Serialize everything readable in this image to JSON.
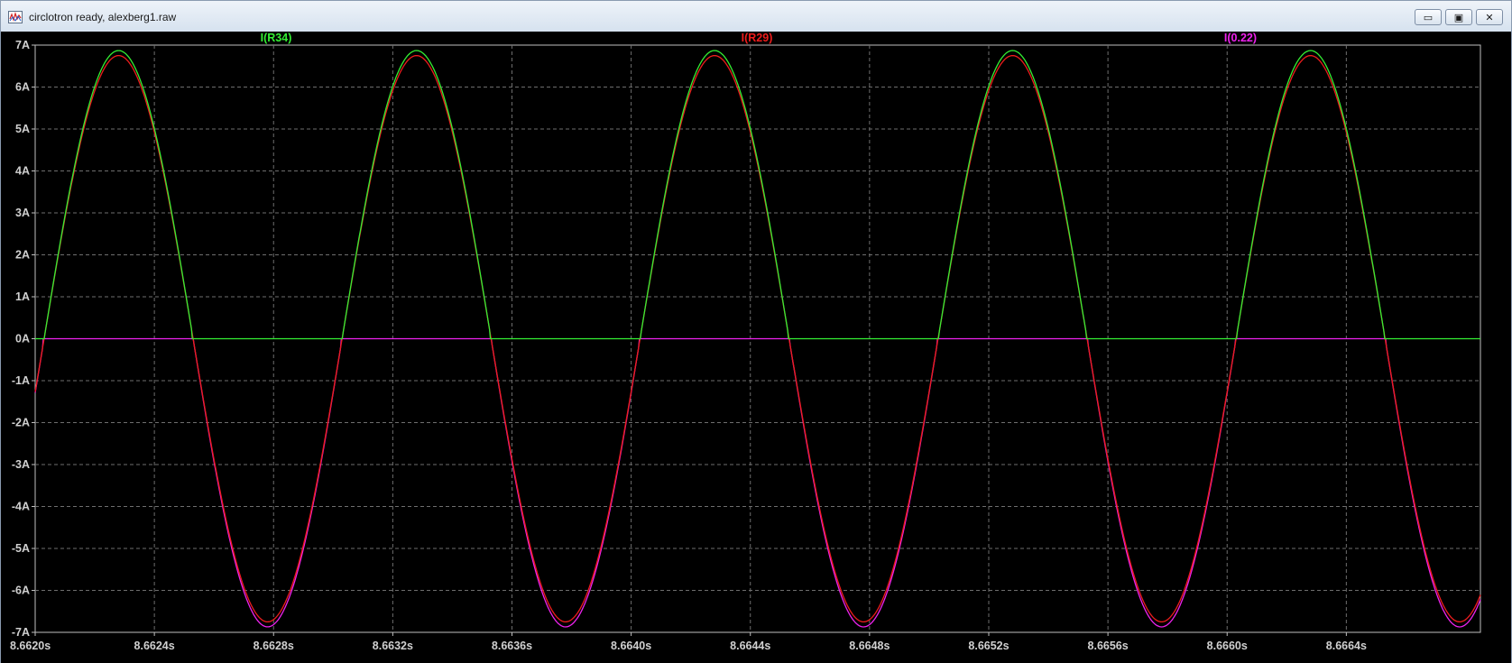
{
  "window": {
    "title": "circlotron ready, alexberg1.raw",
    "buttons": {
      "minimize": "▭",
      "maximize": "▣",
      "close": "✕"
    }
  },
  "chart_data": {
    "type": "line",
    "title": "",
    "xlabel": "",
    "ylabel": "",
    "xlim": [
      8.662,
      8.66685
    ],
    "ylim": [
      -7,
      7
    ],
    "grid": true,
    "legend": "top",
    "background": "#000000",
    "x_ticks": [
      "8.6620s",
      "8.6624s",
      "8.6628s",
      "8.6632s",
      "8.6636s",
      "8.6640s",
      "8.6644s",
      "8.6648s",
      "8.6652s",
      "8.6656s",
      "8.6660s",
      "8.6664s"
    ],
    "y_ticks": [
      "7A",
      "6A",
      "5A",
      "4A",
      "3A",
      "2A",
      "1A",
      "0A",
      "-1A",
      "-2A",
      "-3A",
      "-4A",
      "-5A",
      "-6A",
      "-7A"
    ],
    "series": [
      {
        "name": "I(R34)",
        "color": "#33ee33",
        "peak": 6.87,
        "period": 0.001,
        "phase_start": 8.66203,
        "shape": "positive_half"
      },
      {
        "name": "I(R29)",
        "color": "#ee1c1c",
        "peak": 6.75,
        "period": 0.001,
        "phase_start": 8.66203,
        "shape": "full_sine"
      },
      {
        "name": "I(0.22)",
        "color": "#ee22ee",
        "peak": 6.87,
        "period": 0.001,
        "phase_start": 8.66203,
        "shape": "negative_half"
      }
    ]
  }
}
